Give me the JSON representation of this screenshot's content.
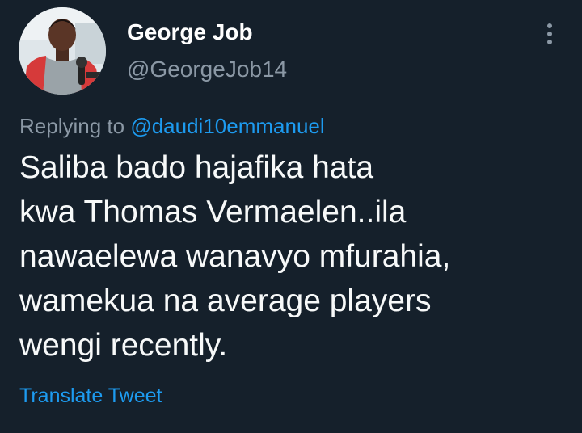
{
  "author": {
    "name": "George Job",
    "handle": "@GeorgeJob14"
  },
  "reply": {
    "prefix": "Replying to ",
    "mention": "@daudi10emmanuel"
  },
  "tweet": {
    "text": "Saliba bado hajafika hata\nkwa Thomas Vermaelen..ila\nnawaelewa wanavyo mfurahia,\nwamekua na average players\nwengi recently."
  },
  "actions": {
    "translate_label": "Translate Tweet"
  },
  "icons": {
    "more": "more-vertical-icon",
    "avatar": "profile-photo"
  },
  "colors": {
    "background": "#15202b",
    "text": "#f7f9f9",
    "secondary": "#8b98a5",
    "accent": "#1d9bf0"
  }
}
